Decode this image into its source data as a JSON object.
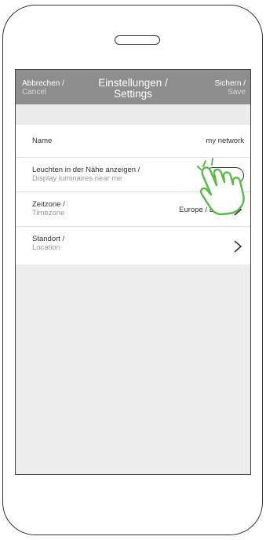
{
  "nav": {
    "cancel_de": "Abbrechen /",
    "cancel_en": "Cancel",
    "title_de": "Einstellungen /",
    "title_en": "Settings",
    "save_de": "Sichern /",
    "save_en": "Save"
  },
  "settings": {
    "name_label": "Name",
    "name_value": "my network",
    "nearby_label_de": "Leuchten in der Nähe anzeigen /",
    "nearby_label_en": "Display luminaires near me",
    "timezone_label_de": "Zeitzone /",
    "timezone_label_en": "Timezone",
    "timezone_value": "Europe / Berlin",
    "location_label_de": "Standort /",
    "location_label_en": "Location"
  },
  "colors": {
    "nav_bg": "#8e8e8e",
    "page_bg": "#ededed",
    "hand_stroke": "#58b947"
  },
  "icons": {
    "pointer": "hand-pointer-icon",
    "chevron": "chevron-right-icon"
  }
}
